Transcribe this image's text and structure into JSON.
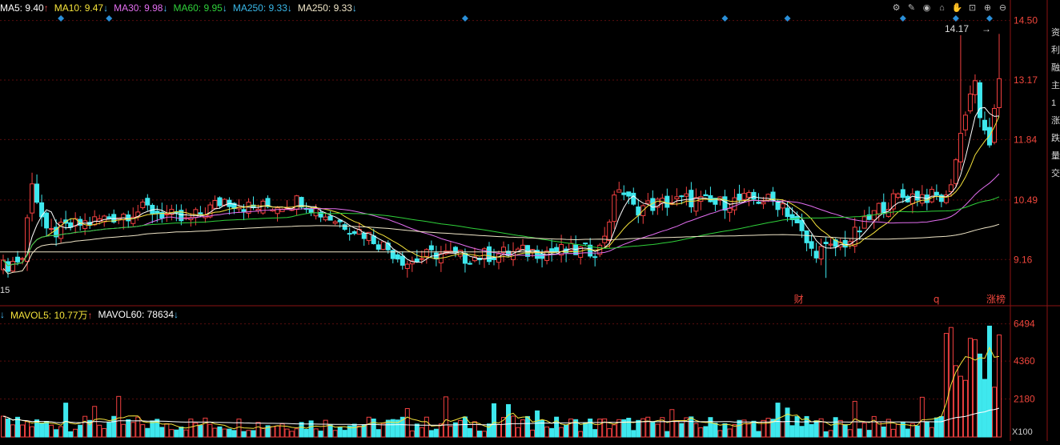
{
  "ma_legend": [
    {
      "label": "MA5: 9.40",
      "arrow": "↑",
      "color": "#ffffff"
    },
    {
      "label": "MA10: 9.47",
      "arrow": "↓",
      "color": "#f5e33b"
    },
    {
      "label": "MA30: 9.98",
      "arrow": "↓",
      "color": "#e36ef0"
    },
    {
      "label": "MA60: 9.95",
      "arrow": "↓",
      "color": "#2fd13a"
    },
    {
      "label": "MA250: 9.33",
      "arrow": "↓",
      "color": "#39b8e8"
    },
    {
      "label": "MA250: 9.33",
      "arrow": "↓",
      "color": "#f0e6c8"
    }
  ],
  "vol_legend": [
    {
      "label": "↓",
      "arrow": "",
      "color": "#4ac3ff"
    },
    {
      "label": "MAVOL5: 10.77万",
      "arrow": "↑",
      "color": "#f5e33b"
    },
    {
      "label": "MAVOL60: 78634",
      "arrow": "↓",
      "color": "#ffffff"
    }
  ],
  "toolbar_icons": [
    "settings-icon",
    "pen-icon",
    "eye-icon",
    "home-icon",
    "hand-icon",
    "lock-icon",
    "zoom-in-icon",
    "zoom-out-icon"
  ],
  "right_edge_chars": [
    "资",
    "利",
    "融",
    "主",
    "1",
    "涨",
    "跌",
    "量",
    "交"
  ],
  "colors": {
    "up": "#f24040",
    "down": "#3ee8ee",
    "grid": "#5a0d0d",
    "axis": "#8c1212",
    "price_label": "#f0463c",
    "marker": "#2a8fd8"
  },
  "chart_data": {
    "type": "candlestick",
    "ylim_price": [
      8.2,
      14.6
    ],
    "y_ticks": [
      "14.50",
      "13.17",
      "11.84",
      "10.49",
      "9.16"
    ],
    "y_tick_values": [
      14.5,
      13.17,
      11.84,
      10.49,
      9.16
    ],
    "vol_ticks": [
      "6494",
      "4360",
      "2180"
    ],
    "vol_tick_values": [
      6494,
      4360,
      2180
    ],
    "vol_unit": "X100",
    "ylim_vol": [
      0,
      6800
    ],
    "max_label": "14.17",
    "min_label_partial": "15",
    "event_labels": [
      {
        "text": "财",
        "index": 143
      },
      {
        "text": "q",
        "index": 168
      },
      {
        "text": "涨榜",
        "index": 177
      }
    ],
    "marker_indices": [
      10,
      19,
      83,
      130,
      141,
      162,
      171,
      177
    ],
    "series_names": [
      "MA5",
      "MA10",
      "MA30",
      "MA60",
      "MA250"
    ]
  }
}
